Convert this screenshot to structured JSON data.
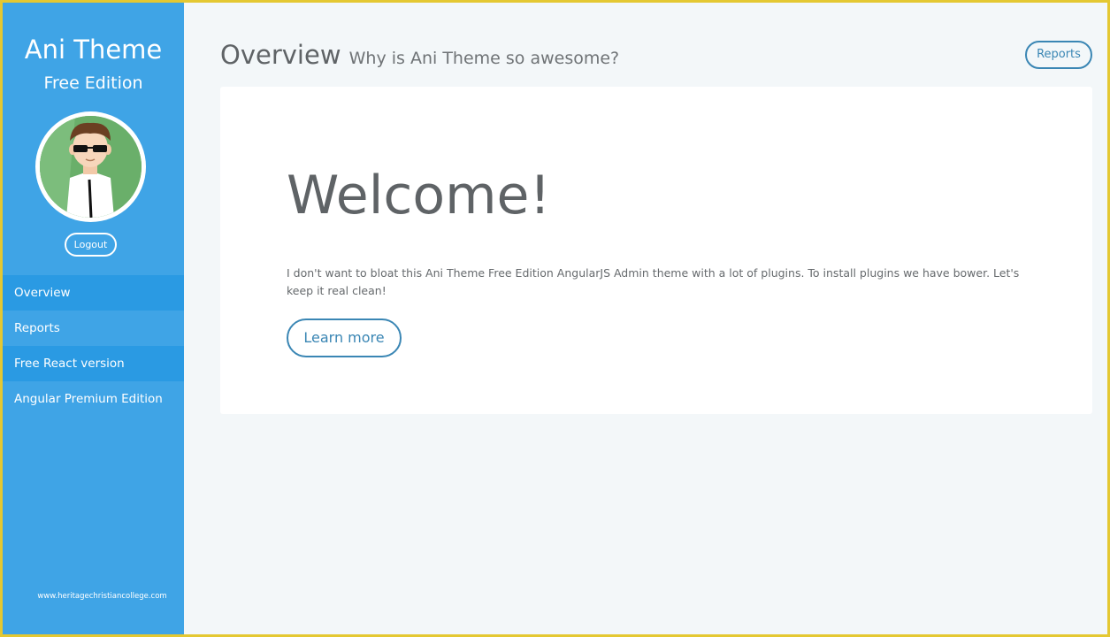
{
  "sidebar": {
    "brand_title": "Ani Theme",
    "brand_subtitle": "Free Edition",
    "logout_label": "Logout",
    "items": [
      {
        "label": "Overview"
      },
      {
        "label": "Reports"
      },
      {
        "label": "Free React version"
      },
      {
        "label": "Angular Premium Edition"
      }
    ],
    "watermark": "www.heritagechristiancollege.com"
  },
  "header": {
    "title": "Overview",
    "subtitle": "Why is Ani Theme so awesome?",
    "reports_button": "Reports"
  },
  "main": {
    "welcome_heading": "Welcome!",
    "description": "I don't want to bloat this Ani Theme Free Edition AngularJS Admin theme with a lot of plugins. To install plugins we have bower. Let's keep it real clean!",
    "learn_more_label": "Learn more"
  },
  "colors": {
    "sidebar": "#3fa4e6",
    "sidebar_active": "#2a9ae3",
    "accent": "#3a86b4",
    "frame": "#e4c832"
  }
}
